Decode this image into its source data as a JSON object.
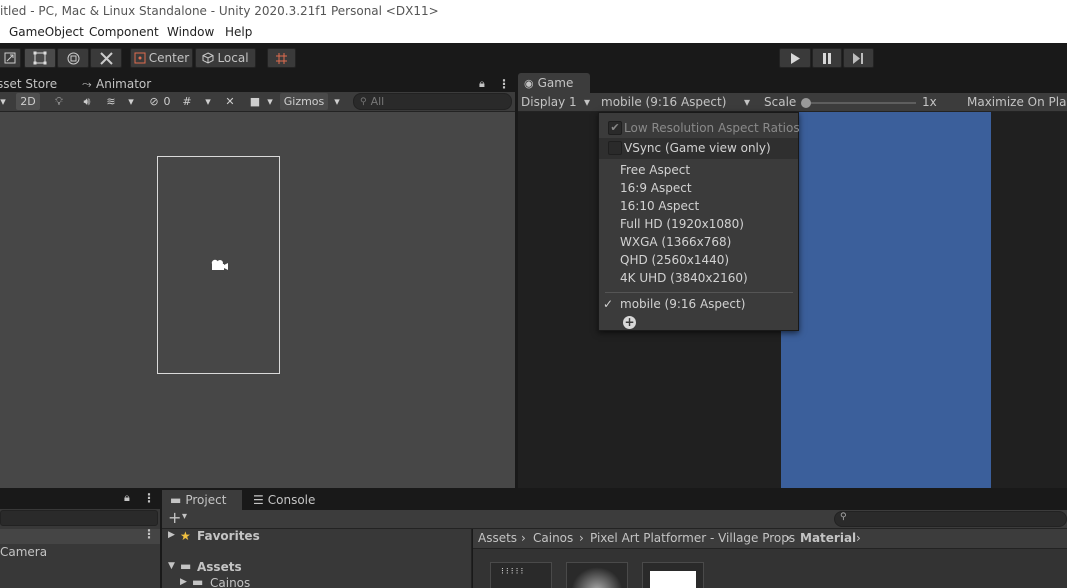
{
  "window": {
    "title": "itled - PC, Mac & Linux Standalone - Unity 2020.3.21f1 Personal <DX11>"
  },
  "menu": [
    "GameObject",
    "Component",
    "Window",
    "Help"
  ],
  "toolbar": {
    "pivot_label": "Center",
    "space_label": "Local"
  },
  "scene": {
    "tabs": [
      "sset Store",
      "Animator"
    ],
    "mode_2d": "2D",
    "hidden_count": "0",
    "gizmos_label": "Gizmos",
    "search_placeholder": "All"
  },
  "game": {
    "tab_label": "Game",
    "display_label": "Display 1",
    "aspect_label": "mobile (9:16 Aspect)",
    "scale_label": "Scale",
    "scale_value": "1x",
    "maximize_label": "Maximize On Play"
  },
  "aspect_menu": {
    "low_res_label": "Low Resolution Aspect Ratios",
    "low_res_checked": true,
    "vsync_label": "VSync (Game view only)",
    "vsync_checked": false,
    "items": [
      "Free Aspect",
      "16:9 Aspect",
      "16:10 Aspect",
      "Full HD (1920x1080)",
      "WXGA (1366x768)",
      "QHD (2560x1440)",
      "4K UHD (3840x2160)"
    ],
    "selected": "mobile (9:16 Aspect)",
    "check_mark": "✓"
  },
  "hierarchy": {
    "item": "Camera"
  },
  "project": {
    "project_tab": "Project",
    "console_tab": "Console",
    "add_label": "+",
    "favorites": "Favorites",
    "assets": "Assets",
    "sub_folder": "Cainos",
    "breadcrumbs": [
      "Assets",
      "Cainos",
      "Pixel Art Platformer - Village Props",
      "Material"
    ]
  },
  "colors": {
    "game_screen": "#3b5f9b",
    "panel": "#3c3c3c",
    "scene_bg": "#474747"
  }
}
